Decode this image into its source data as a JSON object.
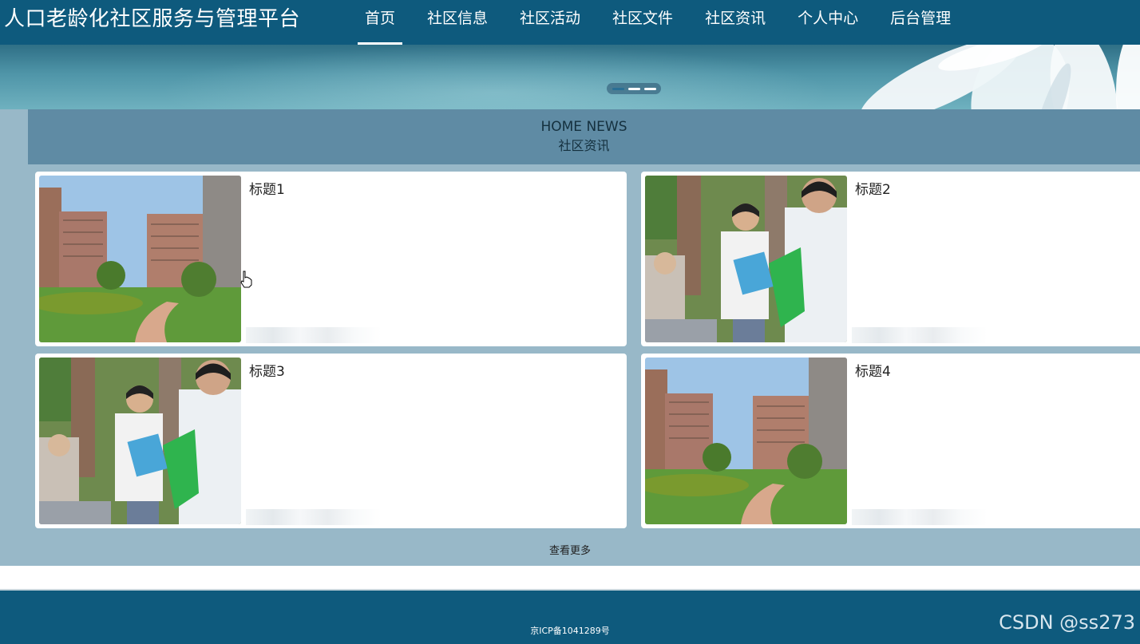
{
  "header": {
    "site_title": "人口老龄化社区服务与管理平台",
    "nav": [
      {
        "label": "首页",
        "active": true
      },
      {
        "label": "社区信息"
      },
      {
        "label": "社区活动"
      },
      {
        "label": "社区文件"
      },
      {
        "label": "社区资讯"
      },
      {
        "label": "个人中心"
      },
      {
        "label": "后台管理"
      }
    ]
  },
  "banner": {
    "slides": 3,
    "active_slide": 1
  },
  "news": {
    "title_en": "HOME NEWS",
    "title_cn": "社区资讯",
    "items": [
      {
        "title": "标题1",
        "image": "buildings-photo-icon"
      },
      {
        "title": "标题2",
        "image": "volunteers-photo-icon"
      },
      {
        "title": "标题3",
        "image": "volunteers-photo-icon"
      },
      {
        "title": "标题4",
        "image": "buildings-photo-icon"
      }
    ],
    "more_label": "查看更多"
  },
  "footer": {
    "icp": "京ICP备1041289号",
    "watermark": "CSDN @ss273"
  },
  "colors": {
    "header_bg": "#0e5a7d",
    "section_bg": "#98b8c8",
    "section_head_bg": "#5f8ba4"
  }
}
